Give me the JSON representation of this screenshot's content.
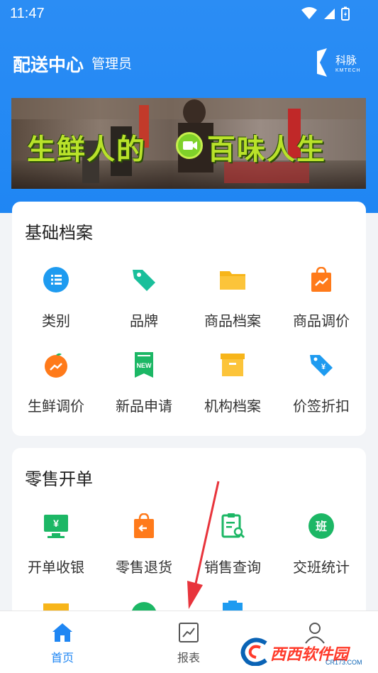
{
  "status_bar": {
    "time": "11:47"
  },
  "header": {
    "title": "配送中心",
    "role": "管理员",
    "brand": "科脉",
    "brand_sub": "KMTECH"
  },
  "banner": {
    "text_left": "生鲜人的",
    "text_right": "百味人生"
  },
  "sections": [
    {
      "title": "基础档案",
      "items": [
        {
          "label": "类别",
          "icon": "list-icon",
          "color": "#1e9bf0"
        },
        {
          "label": "品牌",
          "icon": "tag-icon",
          "color": "#1abf9b"
        },
        {
          "label": "商品档案",
          "icon": "folder-icon",
          "color": "#f7b51a"
        },
        {
          "label": "商品调价",
          "icon": "price-bag-icon",
          "color": "#ff7a1a"
        },
        {
          "label": "生鲜调价",
          "icon": "fresh-price-icon",
          "color": "#ff7a1a"
        },
        {
          "label": "新品申请",
          "icon": "new-product-icon",
          "color": "#1cb765"
        },
        {
          "label": "机构档案",
          "icon": "archive-box-icon",
          "color": "#f7b51a"
        },
        {
          "label": "价签折扣",
          "icon": "discount-tag-icon",
          "color": "#1e9bf0"
        }
      ]
    },
    {
      "title": "零售开单",
      "items": [
        {
          "label": "开单收银",
          "icon": "cashier-icon",
          "color": "#1cb765"
        },
        {
          "label": "零售退货",
          "icon": "return-bag-icon",
          "color": "#ff7a1a"
        },
        {
          "label": "销售查询",
          "icon": "sales-query-icon",
          "color": "#1cb765"
        },
        {
          "label": "交班统计",
          "icon": "shift-icon",
          "color": "#1cb765"
        }
      ]
    }
  ],
  "bottom_nav": [
    {
      "label": "首页",
      "icon": "home-icon",
      "active": true
    },
    {
      "label": "报表",
      "icon": "chart-icon",
      "active": false
    },
    {
      "label": "",
      "icon": "user-icon",
      "active": false
    }
  ],
  "watermark": {
    "text": "西西软件园",
    "sub": "CR173.COM"
  },
  "colors": {
    "primary": "#1f86f3",
    "active": "#1f86f3",
    "annotation_arrow": "#e8343c"
  }
}
